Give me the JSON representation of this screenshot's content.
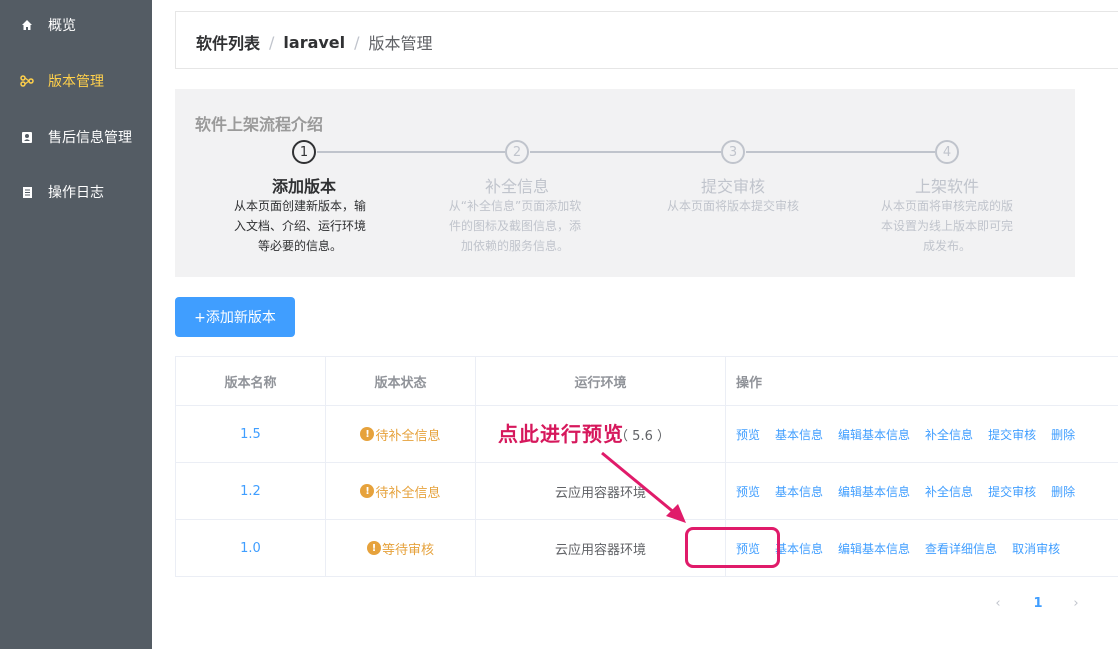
{
  "sidebar": {
    "items": [
      {
        "label": "概览",
        "icon": "home-icon"
      },
      {
        "label": "版本管理",
        "icon": "version-icon",
        "active": true
      },
      {
        "label": "售后信息管理",
        "icon": "contact-card-icon"
      },
      {
        "label": "操作日志",
        "icon": "log-icon"
      }
    ],
    "bg_color": "#545c64",
    "active_color": "#ffd04b"
  },
  "breadcrumb": {
    "items": [
      "软件列表",
      "laravel",
      "版本管理"
    ],
    "separator": "/"
  },
  "steps": {
    "title": "软件上架流程介绍",
    "items": [
      {
        "num": "1",
        "title": "添加版本",
        "desc": "从本页面创建新版本，输入文档、介绍、运行环境等必要的信息。",
        "active": true
      },
      {
        "num": "2",
        "title": "补全信息",
        "desc": "从“补全信息”页面添加软件的图标及截图信息，添加依赖的服务信息。"
      },
      {
        "num": "3",
        "title": "提交审核",
        "desc": "从本页面将版本提交审核"
      },
      {
        "num": "4",
        "title": "上架软件",
        "desc": "从本页面将审核完成的版本设置为线上版本即可完成发布。"
      }
    ]
  },
  "add_button": {
    "label": "+添加新版本"
  },
  "table": {
    "headers": [
      "版本名称",
      "版本状态",
      "运行环境",
      "操作"
    ],
    "rows": [
      {
        "version": "1.5",
        "status": "待补全信息",
        "env": "（ 5.6 ）",
        "actions": [
          "预览",
          "基本信息",
          "编辑基本信息",
          "补全信息",
          "提交审核",
          "删除"
        ]
      },
      {
        "version": "1.2",
        "status": "待补全信息",
        "env": "云应用容器环境",
        "actions": [
          "预览",
          "基本信息",
          "编辑基本信息",
          "补全信息",
          "提交审核",
          "删除"
        ]
      },
      {
        "version": "1.0",
        "status": "等待审核",
        "env": "云应用容器环境",
        "actions": [
          "预览",
          "基本信息",
          "编辑基本信息",
          "查看详细信息",
          "取消审核"
        ]
      }
    ],
    "status_color": "#e6a23c",
    "link_color": "#409eff"
  },
  "pagination": {
    "prev": "‹",
    "current": "1",
    "next": "›"
  },
  "annotation": {
    "text": "点此进行预览",
    "color": "#e01b6a"
  }
}
